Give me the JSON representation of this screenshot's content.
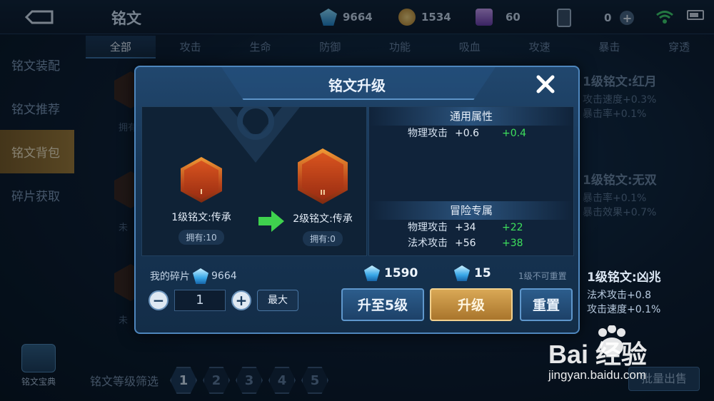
{
  "header": {
    "title": "铭文",
    "currencies": [
      {
        "icon": "diamond-icon",
        "value": "9664"
      },
      {
        "icon": "gold-coin-icon",
        "value": "1534"
      },
      {
        "icon": "gem-icon",
        "value": "60"
      },
      {
        "icon": "card-icon",
        "value": "0"
      }
    ]
  },
  "tabs": [
    "全部",
    "攻击",
    "生命",
    "防御",
    "功能",
    "吸血",
    "攻速",
    "暴击",
    "穿透"
  ],
  "sidebar": {
    "items": [
      {
        "label": "铭文装配"
      },
      {
        "label": "铭文推荐"
      },
      {
        "label": "铭文背包"
      },
      {
        "label": "碎片获取"
      }
    ],
    "codex_label": "铭文宝典"
  },
  "background_cards": {
    "left_labels": [
      "拥有",
      "未",
      "未"
    ],
    "right": [
      {
        "title": "1级铭文:红月",
        "lines": [
          "攻击速度+0.3%",
          "暴击率+0.1%"
        ]
      },
      {
        "title": "1级铭文:无双",
        "lines": [
          "暴击率+0.1%",
          "暴击效果+0.7%"
        ]
      },
      {
        "title": "1级铭文:凶兆",
        "lines": [
          "法术攻击+0.8",
          "攻击速度+0.1%"
        ]
      }
    ]
  },
  "filter": {
    "label": "铭文等级筛选",
    "levels": [
      "1",
      "2",
      "3",
      "4",
      "5"
    ],
    "sell_label": "批量出售"
  },
  "modal": {
    "title": "铭文升级",
    "from": {
      "name": "1级铭文:传承",
      "owned": "拥有:10",
      "roman": "I"
    },
    "to": {
      "name": "2级铭文:传承",
      "owned": "拥有:0",
      "roman": "II"
    },
    "general_header": "通用属性",
    "general_attrs": [
      {
        "name": "物理攻击",
        "value": "+0.6",
        "increase": "+0.4"
      }
    ],
    "adventure_header": "冒险专属",
    "adventure_attrs": [
      {
        "name": "物理攻击",
        "value": "+34",
        "increase": "+22"
      },
      {
        "name": "法术攻击",
        "value": "+56",
        "increase": "+38"
      }
    ],
    "fragments_label": "我的碎片",
    "fragments_value": "9664",
    "quantity": "1",
    "max_label": "最大",
    "cost_upgrade_to5": "1590",
    "cost_upgrade": "15",
    "reset_note": "1级不可重置",
    "btn_upgrade_to5": "升至5级",
    "btn_upgrade": "升级",
    "btn_reset": "重置"
  },
  "watermark": {
    "top": "Bai 经验",
    "bottom": "jingyan.baidu.com"
  },
  "colors": {
    "accent_gold": "#d9a856",
    "increase_green": "#3ee05c",
    "panel_blue": "#173656"
  }
}
